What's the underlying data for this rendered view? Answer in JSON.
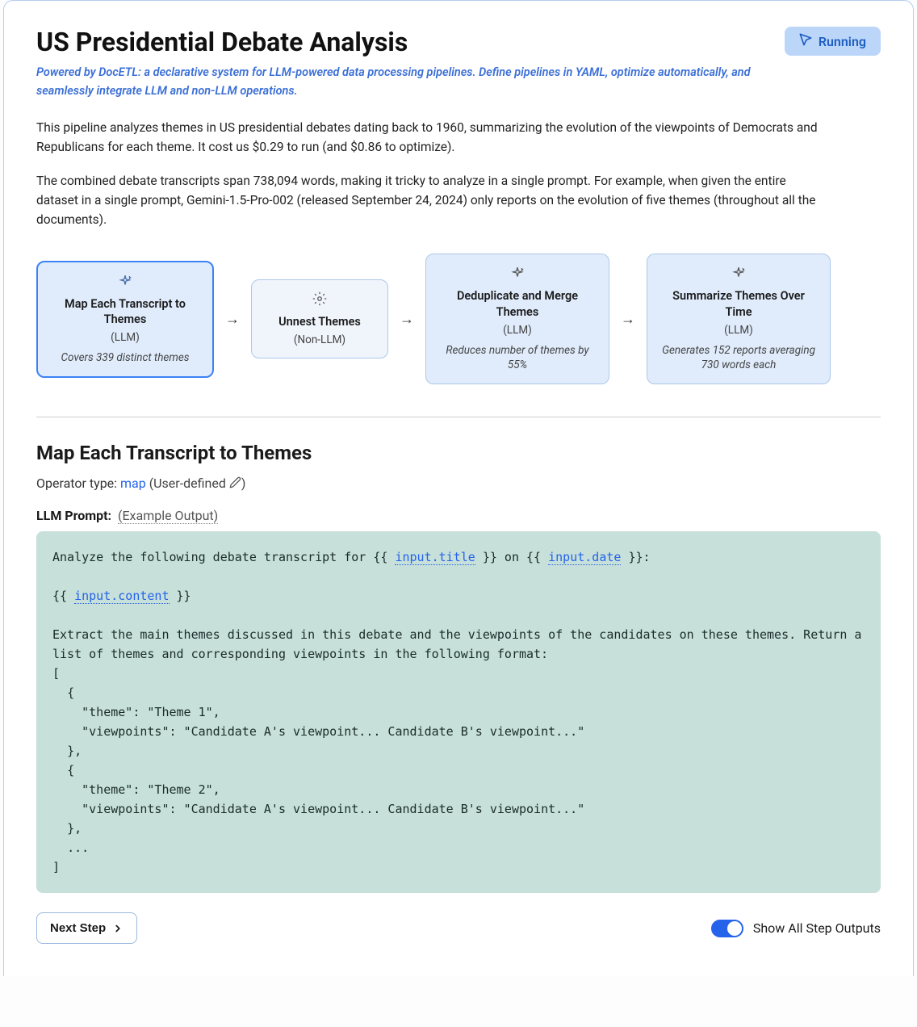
{
  "header": {
    "title": "US Presidential Debate Analysis",
    "status": "Running",
    "subtitle": "Powered by DocETL: a declarative system for LLM-powered data processing pipelines. Define pipelines in YAML, optimize automatically, and seamlessly integrate LLM and non-LLM operations."
  },
  "description": {
    "p1": "This pipeline analyzes themes in US presidential debates dating back to 1960, summarizing the evolution of the viewpoints of Democrats and Republicans for each theme. It cost us $0.29 to run (and $0.86 to optimize).",
    "p2": "The combined debate transcripts span 738,094 words, making it tricky to analyze in a single prompt. For example, when given the entire dataset in a single prompt, Gemini-1.5-Pro-002 (released September 24, 2024) only reports on the evolution of five themes (throughout all the documents)."
  },
  "pipeline": {
    "steps": [
      {
        "title": "Map Each Transcript to Themes",
        "type": "(LLM)",
        "caption": "Covers 339 distinct themes",
        "icon": "sparkle",
        "variant": "active"
      },
      {
        "title": "Unnest Themes",
        "type": "(Non-LLM)",
        "caption": "",
        "icon": "gear",
        "variant": "inactive-light"
      },
      {
        "title": "Deduplicate and Merge Themes",
        "type": "(LLM)",
        "caption": "Reduces number of themes by 55%",
        "icon": "sparkle",
        "variant": "inactive-blue"
      },
      {
        "title": "Summarize Themes Over Time",
        "type": "(LLM)",
        "caption": "Generates 152 reports averaging 730 words each",
        "icon": "sparkle",
        "variant": "inactive-blue"
      }
    ]
  },
  "stepDetail": {
    "heading": "Map Each Transcript to Themes",
    "operatorLabel": "Operator type: ",
    "operatorLink": "map",
    "operatorSuffix": " (User-defined ",
    "operatorSuffix2": ")",
    "promptLabel": "LLM Prompt:",
    "exampleOutput": "(Example Output)",
    "code_pre1": "Analyze the following debate transcript for {{ ",
    "code_var1": "input.title",
    "code_mid1": " }} on {{ ",
    "code_var2": "input.date",
    "code_post1": " }}:",
    "code_pre2": "{{ ",
    "code_var3": "input.content",
    "code_post2": " }}",
    "code_block3": "Extract the main themes discussed in this debate and the viewpoints of the candidates on these themes. Return a list of themes and corresponding viewpoints in the following format:\n[\n  {\n    \"theme\": \"Theme 1\",\n    \"viewpoints\": \"Candidate A's viewpoint... Candidate B's viewpoint...\"\n  },\n  {\n    \"theme\": \"Theme 2\",\n    \"viewpoints\": \"Candidate A's viewpoint... Candidate B's viewpoint...\"\n  },\n  ...\n]"
  },
  "footer": {
    "nextLabel": "Next Step",
    "toggleLabel": "Show All Step Outputs"
  }
}
